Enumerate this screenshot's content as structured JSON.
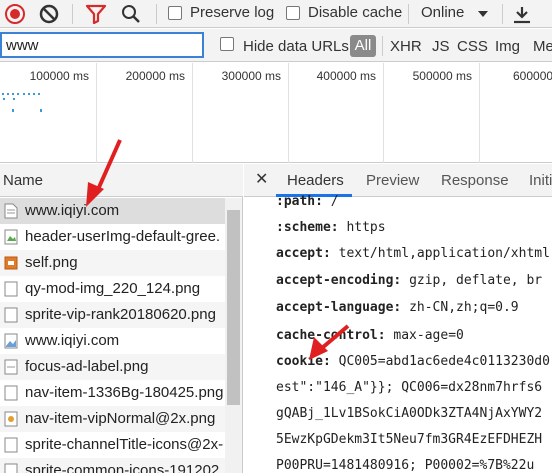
{
  "toolbar": {
    "preserve_log": "Preserve log",
    "disable_cache": "Disable cache",
    "throttle": "Online"
  },
  "filter": {
    "value": "www",
    "hide_data_urls": "Hide data URLs",
    "all": "All",
    "types": [
      "XHR",
      "JS",
      "CSS",
      "Img",
      "Me"
    ]
  },
  "overview": {
    "ticks": [
      "100000 ms",
      "200000 ms",
      "300000 ms",
      "400000 ms",
      "500000 ms",
      "600000"
    ]
  },
  "list": {
    "header": "Name",
    "rows": [
      "www.iqiyi.com",
      "header-userImg-default-gree.",
      "self.png",
      "qy-mod-img_220_124.png",
      "sprite-vip-rank20180620.png",
      "www.iqiyi.com",
      "focus-ad-label.png",
      "nav-item-1336Bg-180425.png",
      "nav-item-vipNormal@2x.png",
      "sprite-channelTitle-icons@2x-",
      "sprite-common-icons-191202"
    ]
  },
  "details": {
    "tabs": [
      "Headers",
      "Preview",
      "Response",
      "Initi"
    ],
    "headers": [
      {
        "name": ":path:",
        "value": "/"
      },
      {
        "name": ":scheme:",
        "value": "https"
      },
      {
        "name": "accept:",
        "value": "text/html,application/xhtml"
      },
      {
        "name": "accept-encoding:",
        "value": "gzip, deflate, br"
      },
      {
        "name": "accept-language:",
        "value": "zh-CN,zh;q=0.9"
      },
      {
        "name": "cache-control:",
        "value": "max-age=0"
      },
      {
        "name": "cookie:",
        "value": "QC005=abd1ac6ede4c0113230d0"
      }
    ],
    "cookie_cont": [
      "est\":\"146_A\"}}; QC006=dx28nm7hrfs6",
      "gQABj_1Lv1BSokCiA0ODk3ZTA4NjAxYWY2",
      "5EwzKpGDekm3It5Neu7fm3GR4EzEFDHEZH",
      "P00PRU=1481480916; P00002=%7B%22u"
    ]
  },
  "colors": {
    "accent": "#1a73e8",
    "record": "#d62b2b",
    "filter_icon": "#d62b2b",
    "annotation_arrow": "#e02020"
  }
}
